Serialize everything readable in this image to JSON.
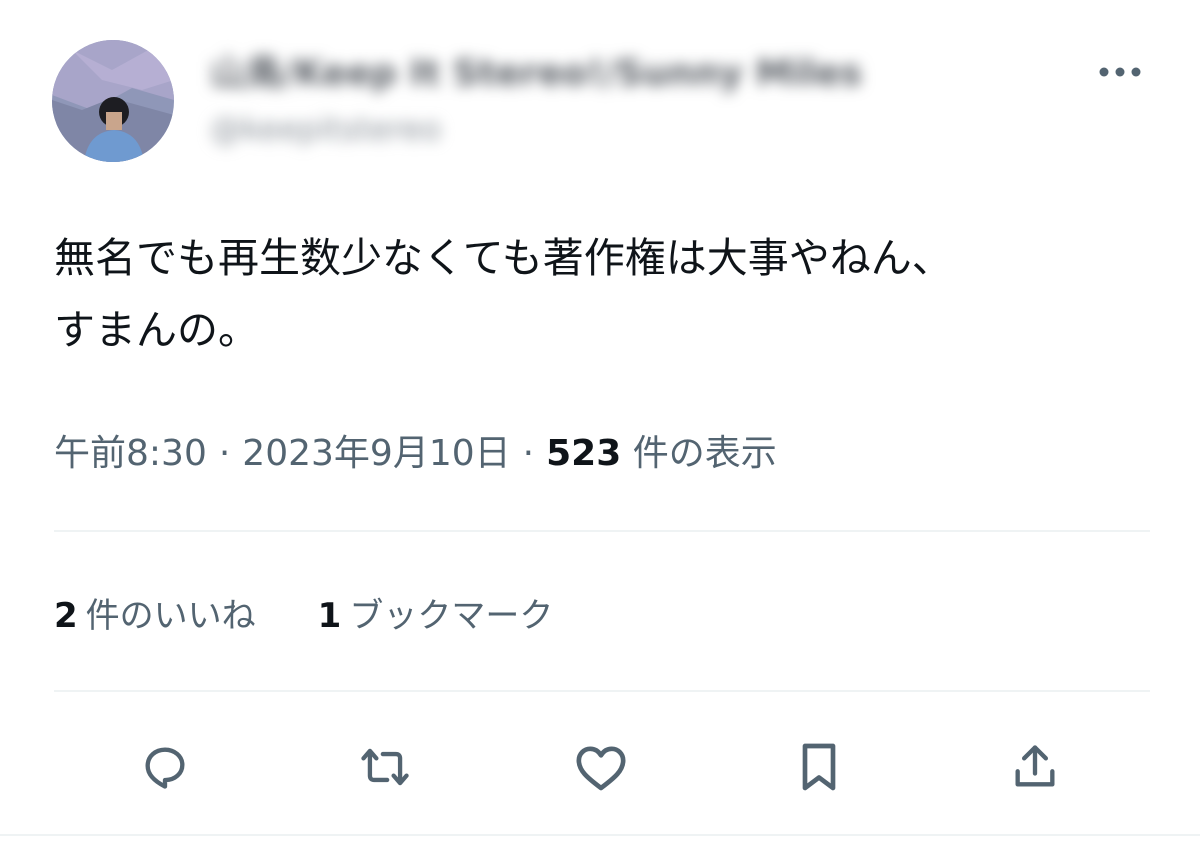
{
  "author": {
    "display_name": "山鳥/Keep It Stereo!/Sunny Miles",
    "handle": "@keepitstereo"
  },
  "tweet": {
    "text": "無名でも再生数少なくても著作権は大事やねん、\nすまんの。"
  },
  "meta": {
    "time": "午前8:30",
    "separator": "·",
    "date": "2023年9月10日",
    "views_count": "523",
    "views_label": "件の表示"
  },
  "stats": {
    "likes_count": "2",
    "likes_label": "件のいいね",
    "bookmarks_count": "1",
    "bookmarks_label": "ブックマーク"
  },
  "icons": {
    "more": "more-horizontal-icon",
    "reply": "reply-icon",
    "retweet": "retweet-icon",
    "like": "heart-icon",
    "bookmark": "bookmark-icon",
    "share": "share-icon"
  },
  "colors": {
    "text": "#0f1419",
    "secondary": "#536471",
    "divider": "#eff3f4"
  }
}
